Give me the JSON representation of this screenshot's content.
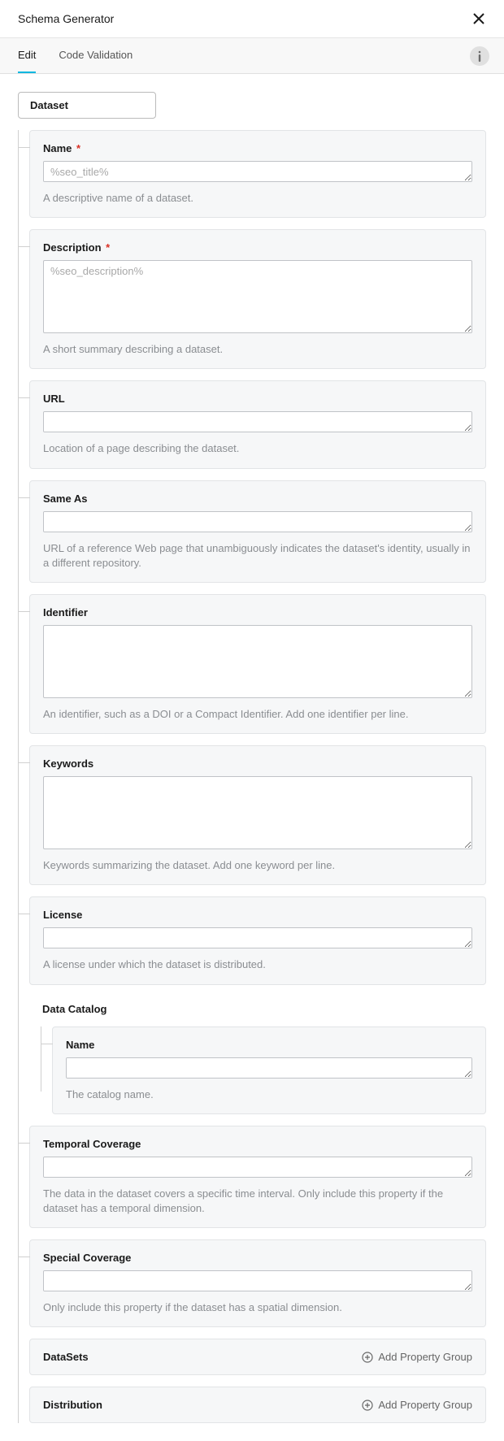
{
  "header": {
    "title": "Schema Generator"
  },
  "tabs": {
    "edit": "Edit",
    "code_validation": "Code Validation"
  },
  "root": {
    "label": "Dataset"
  },
  "fields": {
    "name": {
      "label": "Name",
      "required": "*",
      "placeholder": "%seo_title%",
      "help": "A descriptive name of a dataset."
    },
    "description": {
      "label": "Description",
      "required": "*",
      "placeholder": "%seo_description%",
      "help": "A short summary describing a dataset."
    },
    "url": {
      "label": "URL",
      "help": "Location of a page describing the dataset."
    },
    "same_as": {
      "label": "Same As",
      "help": "URL of a reference Web page that unambiguously indicates the dataset's identity, usually in a different repository."
    },
    "identifier": {
      "label": "Identifier",
      "help": "An identifier, such as a DOI or a Compact Identifier. Add one identifier per line."
    },
    "keywords": {
      "label": "Keywords",
      "help": "Keywords summarizing the dataset. Add one keyword per line."
    },
    "license": {
      "label": "License",
      "help": "A license under which the dataset is distributed."
    },
    "temporal": {
      "label": "Temporal Coverage",
      "help": "The data in the dataset covers a specific time interval. Only include this property if the dataset has a temporal dimension."
    },
    "spatial": {
      "label": "Special Coverage",
      "help": "Only include this property if the dataset has a spatial dimension."
    }
  },
  "data_catalog": {
    "section": "Data Catalog",
    "name": {
      "label": "Name",
      "help": "The catalog name."
    }
  },
  "groups": {
    "datasets": "DataSets",
    "distribution": "Distribution",
    "add_label": "Add Property Group"
  }
}
